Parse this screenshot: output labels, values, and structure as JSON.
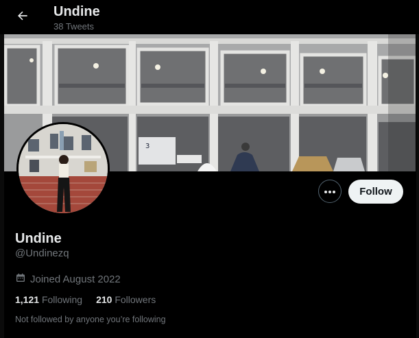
{
  "header": {
    "title": "Undine",
    "tweet_count": "38 Tweets",
    "back_icon": "arrow-left-icon"
  },
  "profile": {
    "display_name": "Undine",
    "handle": "@Undinezq",
    "joined": "Joined August 2022",
    "calendar_icon": "calendar-icon",
    "following_count": "1,121",
    "following_label": "Following",
    "followers_count": "210",
    "followers_label": "Followers",
    "followed_note": "Not followed by anyone you’re following"
  },
  "actions": {
    "more_icon": "more-dots-icon",
    "follow_label": "Follow"
  },
  "colors": {
    "background": "#000000",
    "primary_text": "#e7e9ea",
    "secondary_text": "#71767b",
    "follow_button_bg": "#eff3f4"
  }
}
